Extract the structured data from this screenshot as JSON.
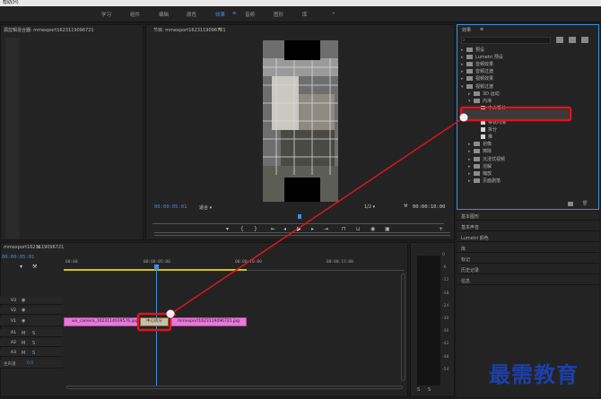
{
  "menu": {
    "help": "帮助(H)"
  },
  "workspaces": [
    {
      "label": "学习",
      "active": false
    },
    {
      "label": "组件",
      "active": false
    },
    {
      "label": "编辑",
      "active": false
    },
    {
      "label": "颜色",
      "active": false
    },
    {
      "label": "效果",
      "active": true
    },
    {
      "label": "音频",
      "active": false
    },
    {
      "label": "图形",
      "active": false
    },
    {
      "label": "库",
      "active": false
    }
  ],
  "workspace_overflow": "»",
  "source_panel": {
    "title": "源剪辑混合器: mmexport1623119096721"
  },
  "program": {
    "title": "节目: mmexport1623119096721",
    "current_tc": "00:00:05:01",
    "fit": "适合",
    "quality": "1/2",
    "duration_tc": "00:00:10:00"
  },
  "effects": {
    "title": "效果",
    "items": [
      {
        "label": "预设",
        "indent": 0,
        "type": "folder",
        "open": false
      },
      {
        "label": "Lumetri 预设",
        "indent": 0,
        "type": "folder",
        "open": false
      },
      {
        "label": "音频效果",
        "indent": 0,
        "type": "folder",
        "open": false
      },
      {
        "label": "音频过渡",
        "indent": 0,
        "type": "folder",
        "open": false
      },
      {
        "label": "视频效果",
        "indent": 0,
        "type": "folder",
        "open": false
      },
      {
        "label": "视频过渡",
        "indent": 0,
        "type": "folder",
        "open": true
      },
      {
        "label": "3D 运动",
        "indent": 1,
        "type": "folder",
        "open": false
      },
      {
        "label": "内滑",
        "indent": 1,
        "type": "folder",
        "open": true
      },
      {
        "label": "中心拆分",
        "indent": 2,
        "type": "fx",
        "selected": true
      },
      {
        "label": "内滑",
        "indent": 2,
        "type": "fx"
      },
      {
        "label": "带状内滑",
        "indent": 2,
        "type": "fx"
      },
      {
        "label": "拆分",
        "indent": 2,
        "type": "fx"
      },
      {
        "label": "推",
        "indent": 2,
        "type": "fx"
      },
      {
        "label": "划像",
        "indent": 1,
        "type": "folder",
        "open": false
      },
      {
        "label": "擦除",
        "indent": 1,
        "type": "folder",
        "open": false
      },
      {
        "label": "沉浸式视频",
        "indent": 1,
        "type": "folder",
        "open": false
      },
      {
        "label": "溶解",
        "indent": 1,
        "type": "folder",
        "open": false
      },
      {
        "label": "缩放",
        "indent": 1,
        "type": "folder",
        "open": false
      },
      {
        "label": "页面剥落",
        "indent": 1,
        "type": "folder",
        "open": false
      }
    ]
  },
  "right_panels": [
    "基本图形",
    "基本声音",
    "Lumetri 颜色",
    "库",
    "标记",
    "历史记录",
    "信息"
  ],
  "timeline": {
    "title": "mmexport1623119096721",
    "tc": "00:00:05:01",
    "ruler": [
      "00:00",
      "00:00:05:00",
      "00:00:10:00",
      "00:00:15:00"
    ],
    "video_tracks": [
      "V3",
      "V2",
      "V1"
    ],
    "audio_tracks": [
      "A1",
      "A2",
      "A3"
    ],
    "master": "主声道",
    "master_value": "0.0",
    "clip1": "wx_camera_1623114039576.jpg",
    "transition": "中心拆分",
    "clip2": "mmexport1623119096721.jpg"
  },
  "meter_ticks": [
    "0",
    "-6",
    "-12",
    "-18",
    "-24",
    "-30",
    "-36",
    "-42",
    "-48",
    "-54"
  ],
  "meter_footer": [
    "S",
    "S"
  ],
  "watermark": "最需教育",
  "colors": {
    "accent": "#3d8fe0",
    "clip": "#e878d9",
    "annotation": "#e0141b"
  }
}
